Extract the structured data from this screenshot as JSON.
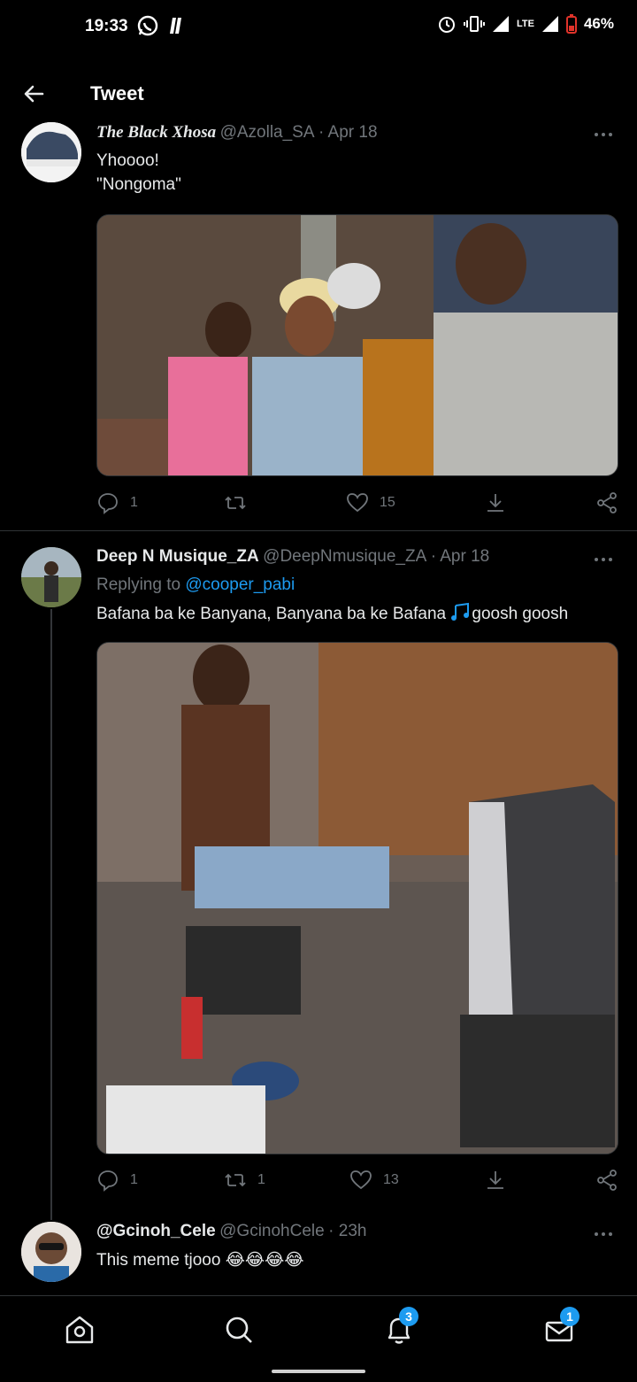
{
  "status_bar": {
    "time": "19:33",
    "network": "LTE",
    "battery": "46%"
  },
  "header": {
    "title": "Tweet"
  },
  "tweets": [
    {
      "name": "The Black Xhosa",
      "handle": "@Azolla_SA",
      "date": "· Apr 18",
      "lines": [
        "Yhoooo!",
        "\"Nongoma\""
      ],
      "reply_count": "1",
      "retweet_count": "",
      "like_count": "15"
    },
    {
      "name": "Deep N Musique_ZA",
      "handle": "@DeepNmusique_ZA",
      "date": "· Apr 18",
      "replying_prefix": "Replying to",
      "replying_to": "@cooper_pabi",
      "text": "Bafana ba ke Banyana, Banyana ba ke Bafana",
      "text_suffix": "goosh goosh",
      "reply_count": "1",
      "retweet_count": "1",
      "like_count": "13"
    },
    {
      "name": "@Gcinoh_Cele",
      "handle": "@GcinohCele",
      "date": "· 23h",
      "text": "This meme tjooo 😂😂😂😂"
    }
  ],
  "bottom_nav": {
    "notifications_badge": "3",
    "messages_badge": "1"
  },
  "colors": {
    "accent": "#1d9bf0",
    "muted": "#71767b",
    "background": "#000000"
  }
}
